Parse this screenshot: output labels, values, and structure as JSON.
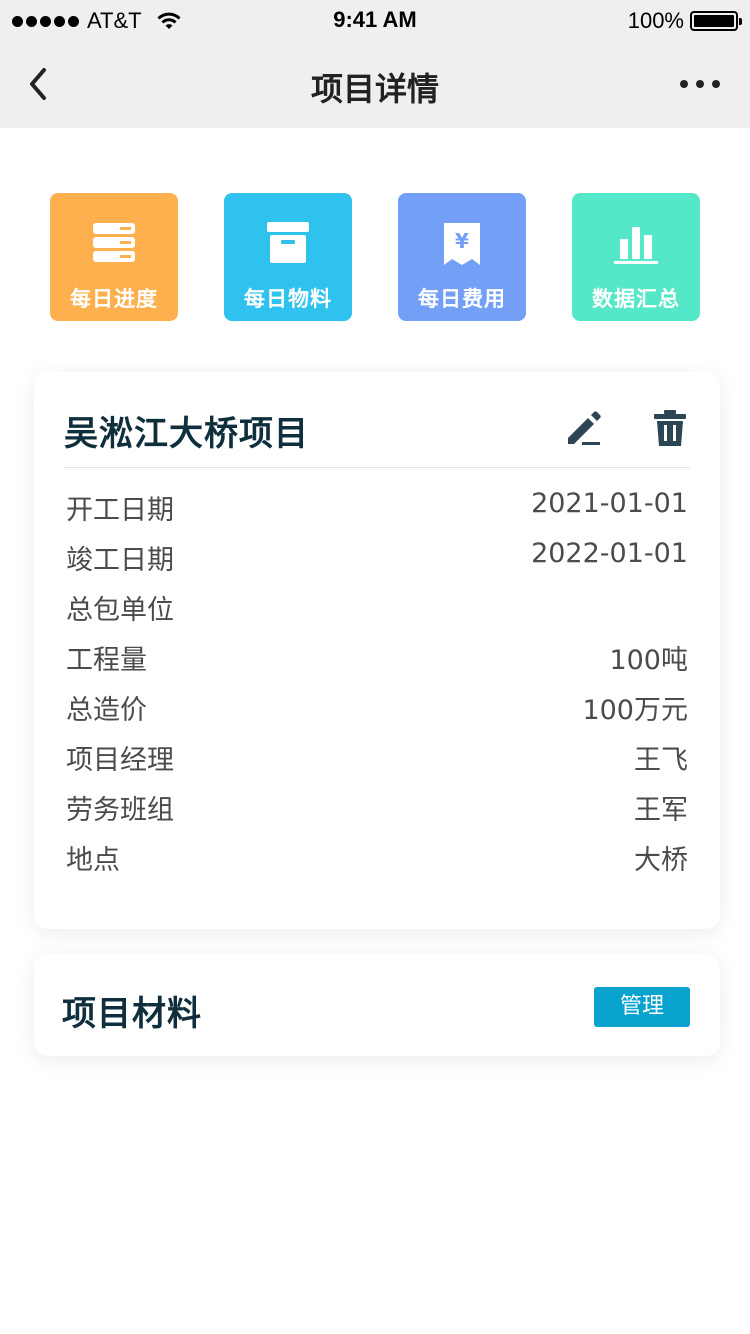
{
  "status": {
    "carrier": "AT&T",
    "time": "9:41 AM",
    "battery": "100%"
  },
  "nav": {
    "title": "项目详情"
  },
  "shortcuts": [
    {
      "label": "每日进度",
      "icon": "server-stack-icon",
      "color": "#FFB04E"
    },
    {
      "label": "每日物料",
      "icon": "archive-box-icon",
      "color": "#2FC2EE"
    },
    {
      "label": "每日费用",
      "icon": "yen-receipt-icon",
      "color": "#739FF6"
    },
    {
      "label": "数据汇总",
      "icon": "bar-chart-icon",
      "color": "#55E8C8"
    }
  ],
  "project": {
    "name": "吴淞江大桥项目",
    "fields": [
      {
        "label": "开工日期",
        "value": "2021-01-01"
      },
      {
        "label": "竣工日期",
        "value": "2022-01-01"
      },
      {
        "label": "总包单位",
        "value": ""
      },
      {
        "label": "工程量",
        "value": "100吨"
      },
      {
        "label": "总造价",
        "value": "100万元"
      },
      {
        "label": "项目经理",
        "value": "王飞"
      },
      {
        "label": "劳务班组",
        "value": "王军"
      },
      {
        "label": "地点",
        "value": "大桥"
      }
    ]
  },
  "materials": {
    "title": "项目材料",
    "manage_label": "管理"
  }
}
